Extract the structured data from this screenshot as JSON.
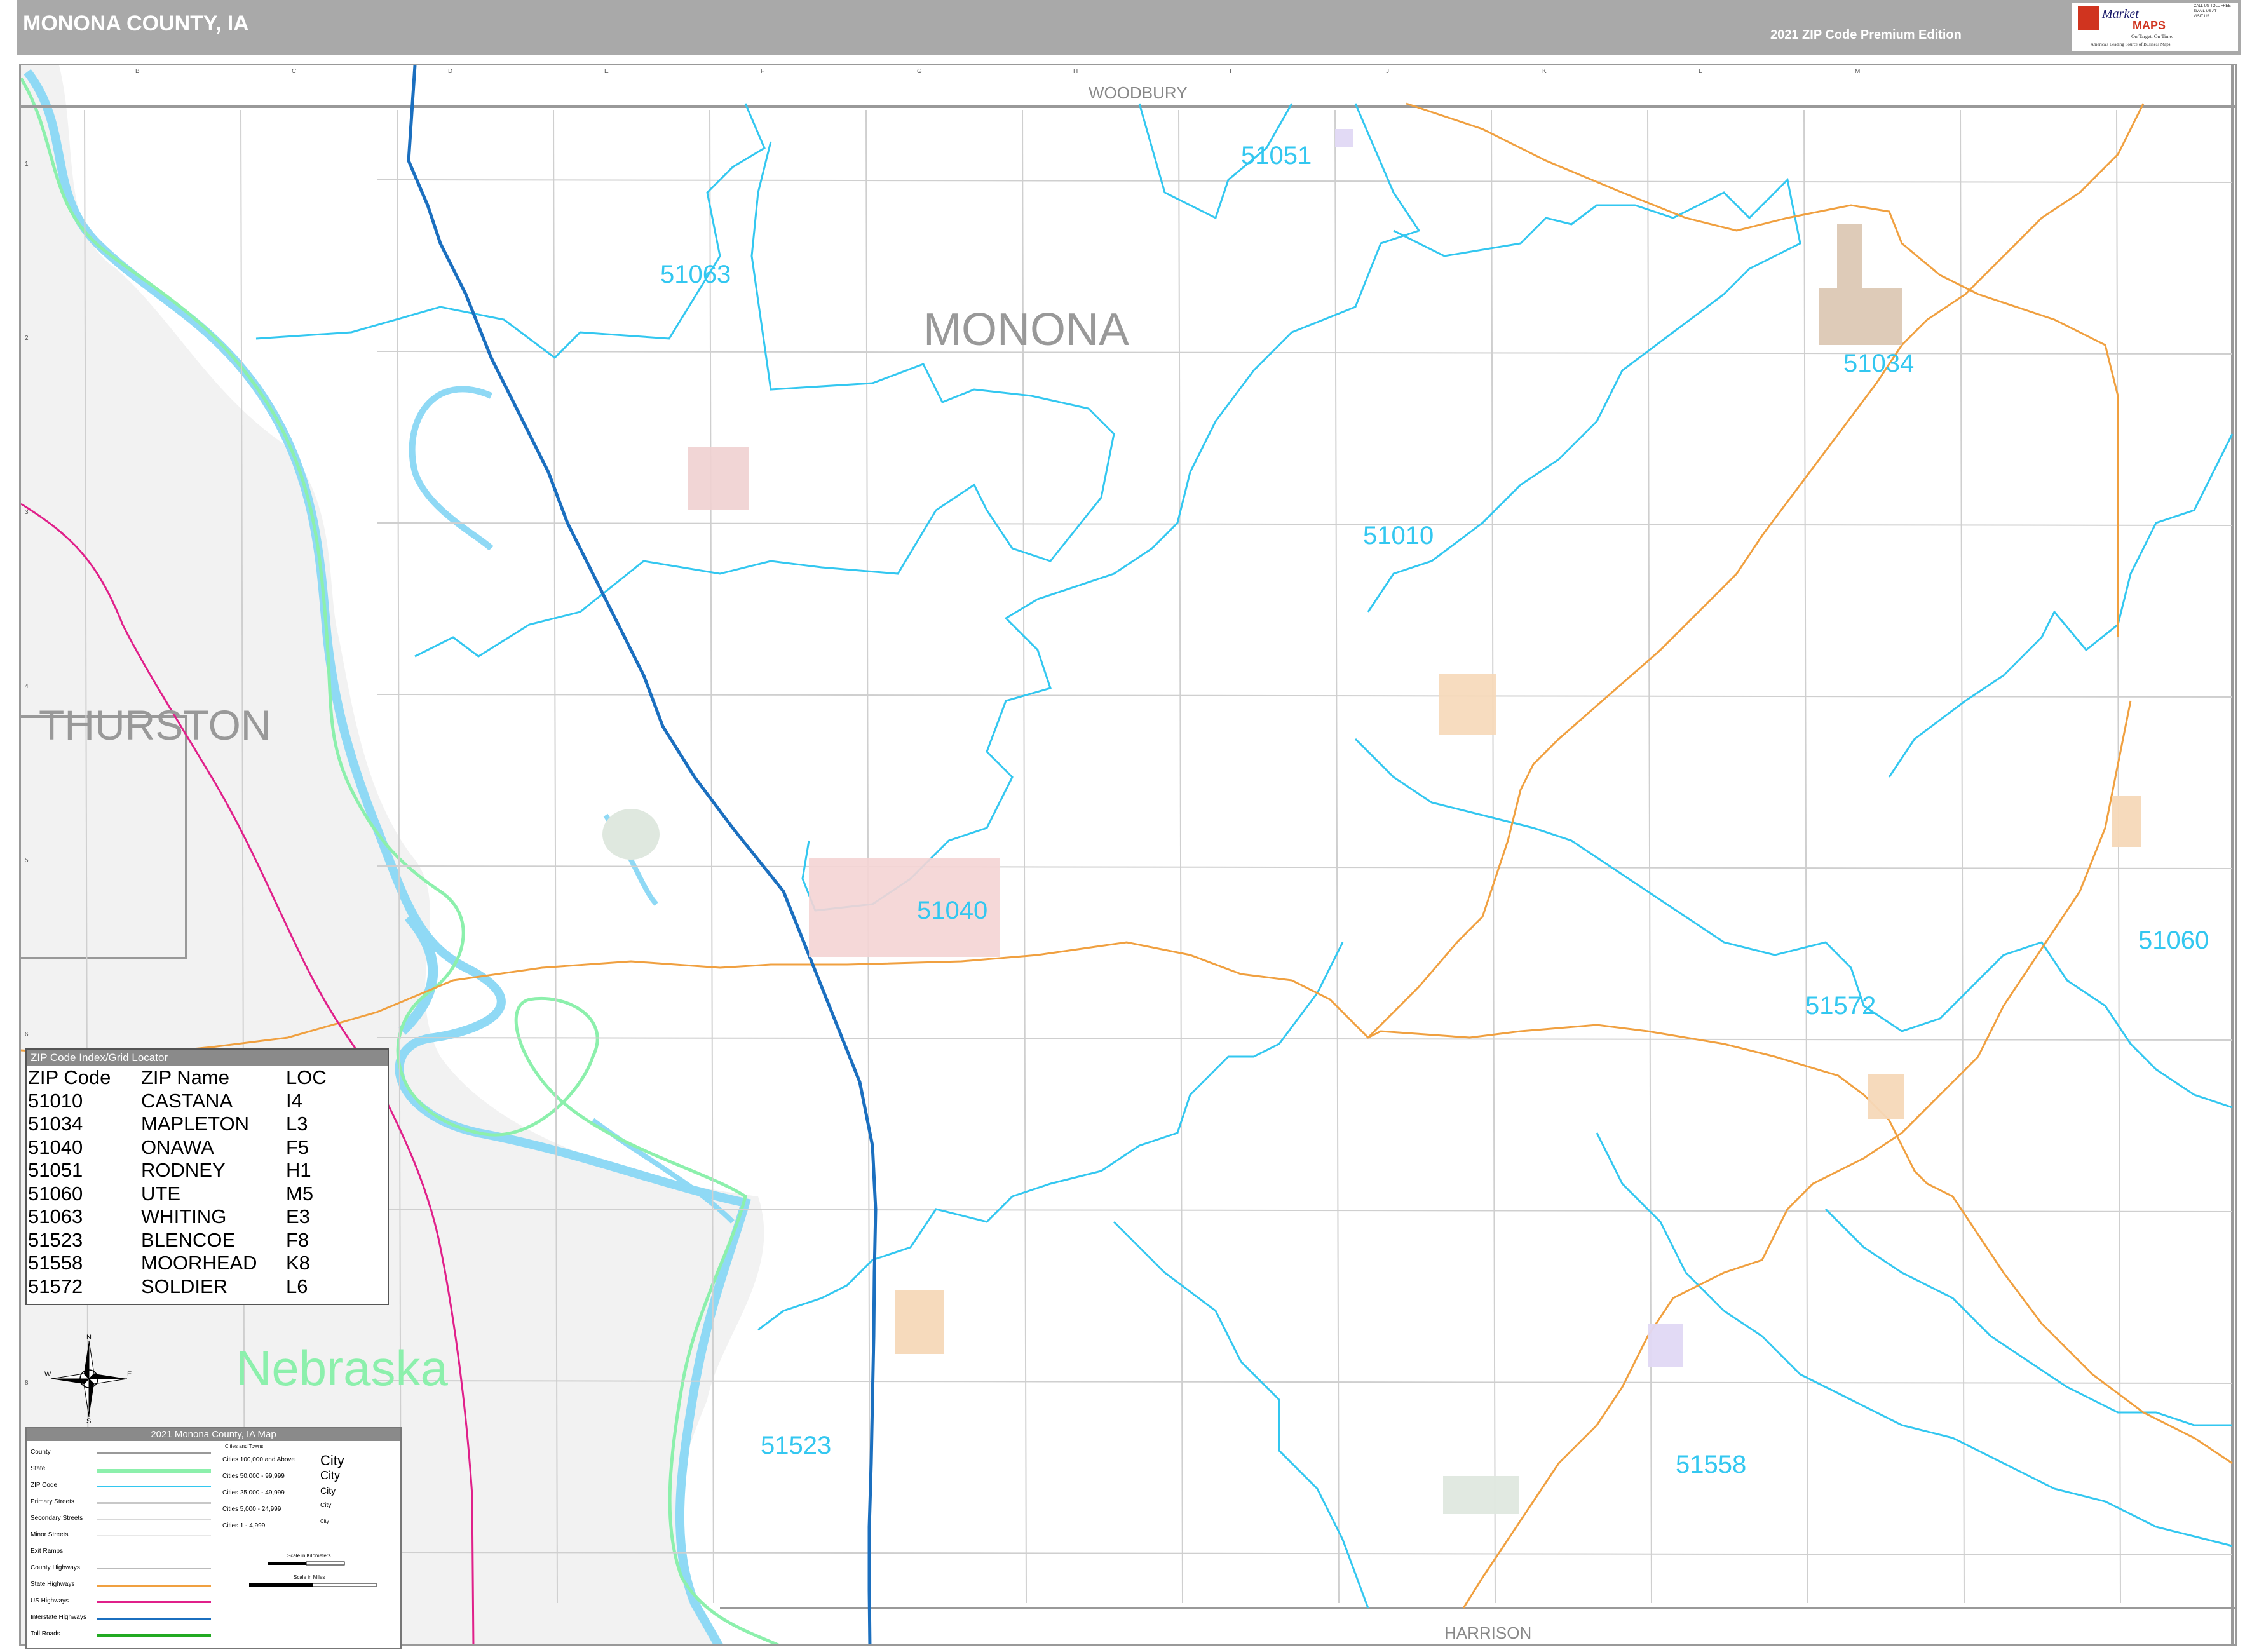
{
  "header": {
    "title": "MONONA COUNTY, IA",
    "edition": "2021 ZIP Code Premium Edition",
    "logo_text": "Market MAPS",
    "logo_tagline": "On Target. On Time.",
    "logo_subtagline": "America's Leading Source of Business Maps"
  },
  "map": {
    "column_labels": [
      "B",
      "C",
      "D",
      "E",
      "F",
      "G",
      "H",
      "I",
      "J",
      "K",
      "L",
      "M"
    ],
    "row_labels": [
      "1",
      "2",
      "3",
      "4",
      "5",
      "6",
      "7",
      "8"
    ],
    "county_labels": {
      "monona": "MONONA",
      "thurston": "THURSTON",
      "woodbury": "WOODBURY",
      "harrison": "HARRISON"
    },
    "state_label": "Nebraska",
    "zip_labels": [
      {
        "code": "51051"
      },
      {
        "code": "51063"
      },
      {
        "code": "51034"
      },
      {
        "code": "51010"
      },
      {
        "code": "51040"
      },
      {
        "code": "51060"
      },
      {
        "code": "51572"
      },
      {
        "code": "51523"
      },
      {
        "code": "51558"
      }
    ],
    "colors": {
      "zip_boundary": "#33c7f0",
      "state_boundary": "#8cf0ac",
      "river": "#8fd9f5",
      "interstate": "#1b6fbf",
      "us_highway": "#e0208a",
      "state_highway": "#f0a040",
      "county_line": "#999999",
      "outside_area": "#f2f2f2"
    }
  },
  "zip_index": {
    "title": "ZIP Code Index/Grid Locator",
    "columns": [
      "ZIP Code",
      "ZIP Name",
      "LOC"
    ],
    "rows": [
      [
        "51010",
        "CASTANA",
        "I4"
      ],
      [
        "51034",
        "MAPLETON",
        "L3"
      ],
      [
        "51040",
        "ONAWA",
        "F5"
      ],
      [
        "51051",
        "RODNEY",
        "H1"
      ],
      [
        "51060",
        "UTE",
        "M5"
      ],
      [
        "51063",
        "WHITING",
        "E3"
      ],
      [
        "51523",
        "BLENCOE",
        "F8"
      ],
      [
        "51558",
        "MOORHEAD",
        "K8"
      ],
      [
        "51572",
        "SOLDIER",
        "L6"
      ]
    ]
  },
  "legend": {
    "title": "2021 Monona County, IA Map",
    "line_items": [
      "County",
      "State",
      "ZIP Code",
      "Primary Streets",
      "Secondary Streets",
      "Minor Streets",
      "Exit Ramps",
      "County Highways",
      "State Highways",
      "US Highways",
      "Interstate Highways",
      "Toll Roads"
    ],
    "city_header": "Cities and Towns",
    "city_items": [
      {
        "label": "Cities 100,000 and Above",
        "sample": "City"
      },
      {
        "label": "Cities 50,000 - 99,999",
        "sample": "City"
      },
      {
        "label": "Cities 25,000 - 49,999",
        "sample": "City"
      },
      {
        "label": "Cities 5,000 - 24,999",
        "sample": "City"
      },
      {
        "label": "Cities 1 - 4,999",
        "sample": "City"
      }
    ],
    "scale_km": "Scale in Kilometers",
    "scale_mi": "Scale in Miles"
  },
  "compass": {
    "n": "N",
    "s": "S",
    "e": "E",
    "w": "W"
  }
}
